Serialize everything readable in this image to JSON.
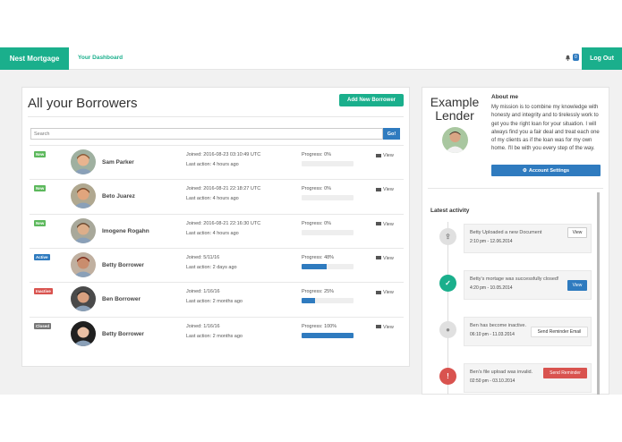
{
  "header": {
    "brand": "Nest Mortgage",
    "nav_dashboard": "Your Dashboard",
    "notification_count": "0",
    "logout_label": "Log Out"
  },
  "borrowers_panel": {
    "title": "All your Borrowers",
    "add_button": "Add New Borrower",
    "search_placeholder": "Search",
    "go_button": "Go!",
    "view_label": "View",
    "rows": [
      {
        "status": "New",
        "status_color": "#5cb85c",
        "name": "Sam Parker",
        "joined": "Joined: 2016-08-23 03:10:49 UTC",
        "last_action": "Last action: 4 hours ago",
        "progress_label": "Progress: 0%",
        "progress": 0
      },
      {
        "status": "New",
        "status_color": "#5cb85c",
        "name": "Beto Juarez",
        "joined": "Joined: 2016-08-21 22:18:27 UTC",
        "last_action": "Last action: 4 hours ago",
        "progress_label": "Progress: 0%",
        "progress": 0
      },
      {
        "status": "New",
        "status_color": "#5cb85c",
        "name": "Imogene Rogahn",
        "joined": "Joined: 2016-08-21 22:16:30 UTC",
        "last_action": "Last action: 4 hours ago",
        "progress_label": "Progress: 0%",
        "progress": 0
      },
      {
        "status": "Active",
        "status_color": "#2f7bbf",
        "name": "Betty Borrower",
        "joined": "Joined: 5/11/16",
        "last_action": "Last action: 2 days ago",
        "progress_label": "Progress: 48%",
        "progress": 48
      },
      {
        "status": "Inactive",
        "status_color": "#d9534f",
        "name": "Ben Borrower",
        "joined": "Joined: 1/16/16",
        "last_action": "Last action: 2 months ago",
        "progress_label": "Progress: 25%",
        "progress": 25
      },
      {
        "status": "Closed",
        "status_color": "#777777",
        "name": "Betty Borrower",
        "joined": "Joined: 1/16/16",
        "last_action": "Last action: 2 months ago",
        "progress_label": "Progress: 100%",
        "progress": 100
      }
    ]
  },
  "lender_panel": {
    "name_line1": "Example",
    "name_line2": "Lender",
    "about_heading": "About me",
    "about_text": "My mission is to combine my knowledge with honesty and integrity and to tirelessly work to get you the right loan for your situation. I will always find you a fair deal and treat each one of my clients as if the loan was for my own home. I'll be with you every step of the way.",
    "account_settings": "Account Settings",
    "activity_heading": "Latest activity",
    "activities": [
      {
        "icon": "upload-icon",
        "color": "#e0e0e0",
        "text": "Betty Uploaded a new Document",
        "time": "2:10 pm - 12.06.2014",
        "button": "View",
        "button_style": "plain"
      },
      {
        "icon": "check-icon",
        "color": "#1aaf8c",
        "text": "Betty's mortage was successfully closed!",
        "time": "4:20 pm - 10.05.2014",
        "button": "View",
        "button_style": "primary"
      },
      {
        "icon": "user-icon",
        "color": "#e0e0e0",
        "text": "Ben has become inactive.",
        "time": "06:10 pm - 11.03.2014",
        "button": "Send Reminder Email",
        "button_style": "plain"
      },
      {
        "icon": "warning-icon",
        "color": "#d9534f",
        "text": "Ben's file upload was invalid.",
        "time": "02:50 pm - 03.10.2014",
        "button": "Send Reminder",
        "button_style": "danger"
      }
    ]
  }
}
